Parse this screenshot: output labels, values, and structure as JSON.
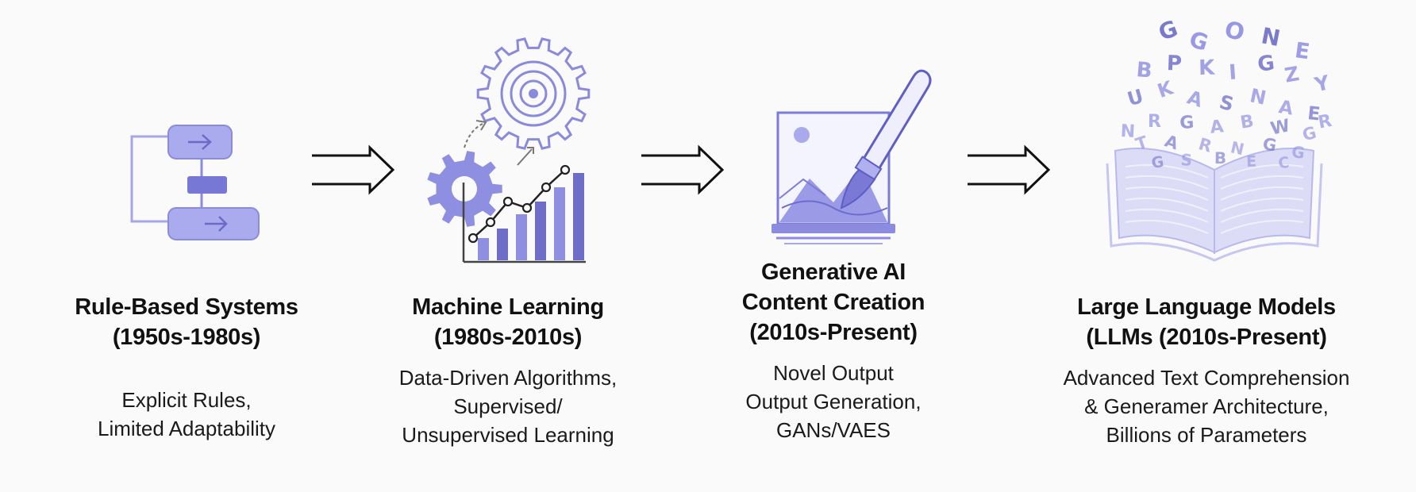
{
  "colors": {
    "accent": "#8f8fe2",
    "accent_dark": "#6e6ec9",
    "accent_light": "#c9c9f2",
    "arrow": "#111111",
    "text": "#111111"
  },
  "stages": [
    {
      "icon": "flowchart-icon",
      "title": [
        "Rule-Based Systems",
        "(1950s-1980s)"
      ],
      "desc": [
        "Explicit Rules,",
        "Limited Adaptability"
      ]
    },
    {
      "icon": "gear-chart-icon",
      "title": [
        "Machine Learning",
        "(1980s-2010s)"
      ],
      "desc": [
        "Data-Driven Algorithms,",
        "Supervised/",
        "Unsupervised Learning"
      ]
    },
    {
      "icon": "image-paintbrush-icon",
      "title": [
        "Generative AI",
        "Content Creation",
        "(2010s-Present)"
      ],
      "desc": [
        "Novel Output",
        "Output Generation,",
        "GANs/VAES"
      ]
    },
    {
      "icon": "open-book-letters-icon",
      "title": [
        "Large Language Models",
        "(LLMs (2010s-Present)"
      ],
      "desc": [
        "Advanced Text Comprehension",
        "& Generamer Architecture,",
        "Billions of Parameters"
      ]
    }
  ],
  "book_letters": [
    "G",
    "G",
    "O",
    "N",
    "E",
    "B",
    "P",
    "K",
    "I",
    "G",
    "Z",
    "Y",
    "U",
    "K",
    "A",
    "S",
    "N",
    "A",
    "E",
    "N",
    "R",
    "G",
    "A",
    "B",
    "W",
    "G",
    "T",
    "A",
    "R",
    "N",
    "G",
    "G",
    "S",
    "B",
    "E",
    "C",
    "G",
    "R"
  ]
}
